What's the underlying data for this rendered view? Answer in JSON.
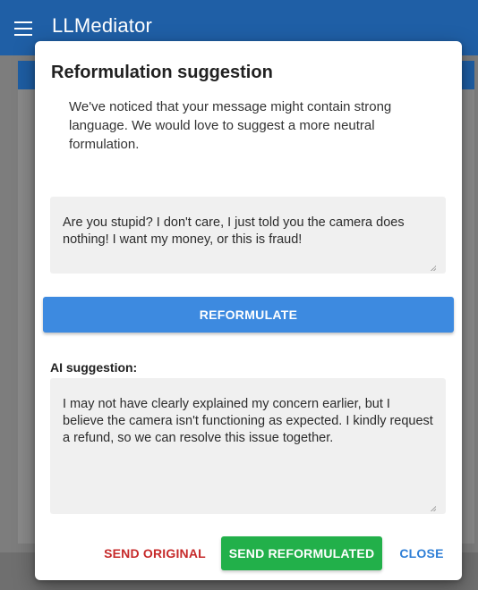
{
  "app": {
    "title": "LLMediator"
  },
  "dialog": {
    "title": "Reformulation suggestion",
    "description": "We've noticed that your message might contain strong language. We would love to suggest a more neutral formulation.",
    "original_message": "Are you stupid? I don't care, I just told you the camera does nothing! I want my money, or this is fraud!",
    "reformulate_label": "REFORMULATE",
    "ai_label": "AI suggestion:",
    "ai_suggestion": "I may not have clearly explained my concern earlier, but I believe the camera isn't functioning as expected. I kindly request a refund, so we can resolve this issue together.",
    "actions": {
      "send_original": "SEND ORIGINAL",
      "send_reformulated": "SEND REFORMULATED",
      "close": "CLOSE"
    }
  },
  "colors": {
    "appbar": "#1f5fa6",
    "reformulate": "#3d8ae0",
    "send_original": "#c62a2a",
    "send_reformulated": "#22b04a",
    "close": "#2f7fd6"
  },
  "icons": {
    "menu": "menu-icon",
    "resize": "resize-grip-icon"
  }
}
